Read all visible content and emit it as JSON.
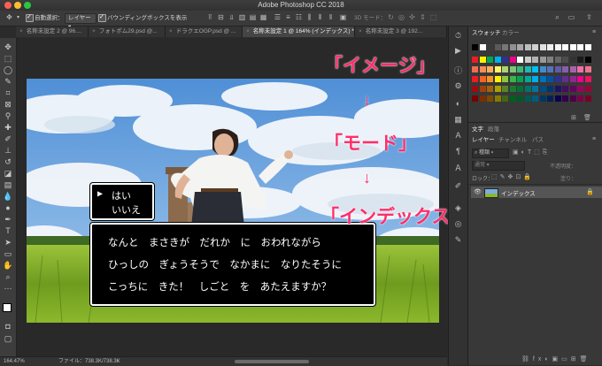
{
  "window": {
    "title": "Adobe Photoshop CC 2018",
    "traffic_colors": [
      "#fe5f57",
      "#febc2e",
      "#28c840"
    ]
  },
  "options_bar": {
    "auto_select_label": "自動選択：",
    "layer_select_value": "レイヤー",
    "bbox_label": "バウンディングボックスを表示",
    "mode_3d_label": "3D モード："
  },
  "tabs": [
    {
      "label": "名称未設定 2 @ 96...."
    },
    {
      "label": "フォトポム29.psd @..."
    },
    {
      "label": "ドラクエOGP.psd @ ..."
    },
    {
      "label": "名称未設定 1 @ 164% (インデックス) *"
    },
    {
      "label": "名称未設定 3 @ 192..."
    }
  ],
  "canvas": {
    "annotation_1": "「イメージ」",
    "annotation_2": "「モード」",
    "annotation_3": "「インデックスカラー」",
    "arrow_glyph": "↓",
    "dialog_small": {
      "cursor": "▶",
      "option_1": "はい",
      "option_2": "いいえ"
    },
    "dialog_main": {
      "line_1": "なんと　まさきが　だれか　に　おわれながら",
      "line_2": "ひっしの　ぎょうそうで　なかまに　なりたそうに",
      "line_3": "こっちに　きた！　しごと　を　あたえますか？"
    }
  },
  "status_bar": {
    "zoom": "164.47%",
    "file_info": "ファイル：738.3K/738.3K"
  },
  "swatches_panel": {
    "tab_swatches": "スウォッチ",
    "tab_color": "カラー",
    "colors": [
      [
        "#000000",
        "#ffffff",
        "#3a3a3a",
        "#5a5a5a",
        "#777777",
        "#909090",
        "#a8a8a8",
        "#bdbdbd",
        "#d0d0d0",
        "#e0e0e0",
        "#eeeeee",
        "#f5f5f5",
        "#ffffff",
        "#ffffff",
        "#ffffff",
        "#ffffff"
      ],
      [
        "#ed1c24",
        "#fff200",
        "#00a651",
        "#00aeef",
        "#2e3192",
        "#ec008c",
        "#ffffff",
        "#cccccc",
        "#b3b3b3",
        "#999999",
        "#808080",
        "#666666",
        "#4d4d4d",
        "#333333",
        "#1a1a1a",
        "#000000"
      ],
      [
        "#f26c4f",
        "#f68e55",
        "#fbaf5c",
        "#fff467",
        "#acd372",
        "#7cc576",
        "#3bb878",
        "#1abbb4",
        "#00bff3",
        "#438ccb",
        "#5574b9",
        "#605ca8",
        "#855fa8",
        "#a763a8",
        "#f06ea9",
        "#f2728c"
      ],
      [
        "#ed1c24",
        "#f26522",
        "#f7941d",
        "#fff200",
        "#8dc73f",
        "#39b54a",
        "#00a651",
        "#00a99d",
        "#00aeef",
        "#0072bc",
        "#0054a6",
        "#2e3192",
        "#662d91",
        "#92278f",
        "#ec008c",
        "#ed145b"
      ],
      [
        "#9e0b0f",
        "#a0410d",
        "#a36209",
        "#aba000",
        "#598527",
        "#1a7b30",
        "#007236",
        "#00746b",
        "#0076a3",
        "#004b80",
        "#003471",
        "#1b1464",
        "#440e62",
        "#630460",
        "#9e005d",
        "#9e0039"
      ],
      [
        "#790000",
        "#7b2e00",
        "#7d4900",
        "#827b00",
        "#406618",
        "#005e20",
        "#005826",
        "#005952",
        "#005b7f",
        "#003663",
        "#002157",
        "#0d004c",
        "#32004b",
        "#4b0049",
        "#7b0046",
        "#7a0026"
      ]
    ]
  },
  "layers_panel": {
    "tab_char": "文字",
    "tab_para": "段落",
    "tab_layers": "レイヤー",
    "tab_channels": "チャンネル",
    "tab_paths": "パス",
    "kind_label": "種類",
    "blend_mode": "通常",
    "opacity_label": "不透明度：",
    "lock_label": "ロック：",
    "fill_label": "塗り：",
    "layer_name": "インデックス"
  }
}
